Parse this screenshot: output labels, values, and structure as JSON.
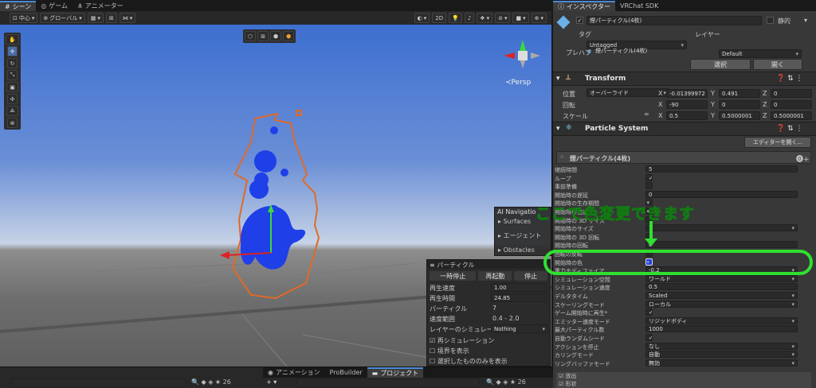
{
  "scene_tabs": {
    "scene": "シーン",
    "game": "ゲーム",
    "animator": "アニメーター"
  },
  "scene_toolbar": {
    "pivot": "中心",
    "space": "グローバル",
    "mode_2d": "2D"
  },
  "gizmo": {
    "persp": "≺Persp"
  },
  "ai_navigation": {
    "title": "AI Navigatio",
    "items": [
      "Surfaces",
      "エージェント",
      "Obstacles"
    ]
  },
  "particle_panel": {
    "title": "パーティクル",
    "pause": "一時停止",
    "restart": "再起動",
    "stop": "停止",
    "rows": [
      {
        "label": "再生速度",
        "value": "1.00"
      },
      {
        "label": "再生時間",
        "value": "24.85"
      },
      {
        "label": "パーティクル",
        "value": "7"
      },
      {
        "label": "速度範囲",
        "value": "0.4 - 2.0"
      }
    ],
    "sim_layer_label": "レイヤーのシミュレーショ",
    "sim_layer_value": "Nothing",
    "checks": [
      {
        "label": "再シミュレーション",
        "checked": true
      },
      {
        "label": "境界を表示",
        "checked": false
      },
      {
        "label": "選択したもののみを表示",
        "checked": false
      }
    ]
  },
  "bottom_tabs": {
    "animation": "アニメーション",
    "probuilder": "ProBuilder",
    "project": "プロジェクト",
    "count": "26"
  },
  "inspector_tabs": {
    "inspector": "インスペクター",
    "vrchat": "VRChat SDK"
  },
  "object": {
    "name": "煙パーティクル(4枚)",
    "static": "静的",
    "tag_label": "タグ",
    "tag": "Untagged",
    "layer_label": "レイヤー",
    "layer": "Default",
    "prefab_label": "プレハブ",
    "prefab_name": "煙パーティクル(4枚)",
    "override": "オーバーライド",
    "select": "選択",
    "open": "開く"
  },
  "transform": {
    "title": "Transform",
    "position_label": "位置",
    "rotation_label": "回転",
    "scale_label": "スケール",
    "position": [
      "-0.01399972",
      "0.491",
      "0"
    ],
    "rotation": [
      "-90",
      "0",
      "0"
    ],
    "scale": [
      "0.5",
      "0.5000001",
      "0.5000001"
    ]
  },
  "particle_system": {
    "title": "Particle System",
    "open_editor": "エディターを開く...",
    "module_name": "煙パーティクル(4枚)",
    "annotation": "ここで色変更できます",
    "rows": [
      {
        "label": "継続時間",
        "value": "5"
      },
      {
        "label": "ループ",
        "value": "✓"
      },
      {
        "label": "事前準備",
        "value": ""
      },
      {
        "label": "開始時の遅延",
        "value": "0"
      },
      {
        "label": "開始時の生存期間",
        "value": ""
      },
      {
        "label": "開始時の速度",
        "value": ""
      },
      {
        "label": "開始時の 3D サイズ",
        "value": ""
      },
      {
        "label": "開始時のサイズ",
        "value": "1"
      },
      {
        "label": "開始時の 3D 回転",
        "value": ""
      },
      {
        "label": "開始時の回転",
        "value": "0"
      },
      {
        "label": "回転の反転",
        "value": ""
      },
      {
        "label": "開始時の色",
        "value": ""
      },
      {
        "label": "重力モディファイア",
        "value": "-0.2"
      },
      {
        "label": "シミュレーション空間",
        "value": "ワールド"
      },
      {
        "label": "シミュレーション速度",
        "value": "0.5"
      },
      {
        "label": "デルタタイム",
        "value": "Scaled"
      },
      {
        "label": "スケーリングモード",
        "value": "ローカル"
      },
      {
        "label": "ゲーム開始時に再生*",
        "value": "✓"
      },
      {
        "label": "エミッター速度モード",
        "value": "リジッドボディ"
      },
      {
        "label": "最大パーティクル数",
        "value": "1000"
      },
      {
        "label": "自動ランダムシード",
        "value": "✓"
      },
      {
        "label": "アクションを停止",
        "value": "なし"
      },
      {
        "label": "カリングモード",
        "value": "自動"
      },
      {
        "label": "リングバッファモード",
        "value": "無効"
      }
    ],
    "sub_modules": [
      "放出",
      "形状"
    ]
  },
  "colors": {
    "accent": "#4a8ad8",
    "annotation": "#2fe02f",
    "selection_orange": "#e06a28",
    "sky_top": "#3d6fd0",
    "ground": "#6e6e6e"
  }
}
